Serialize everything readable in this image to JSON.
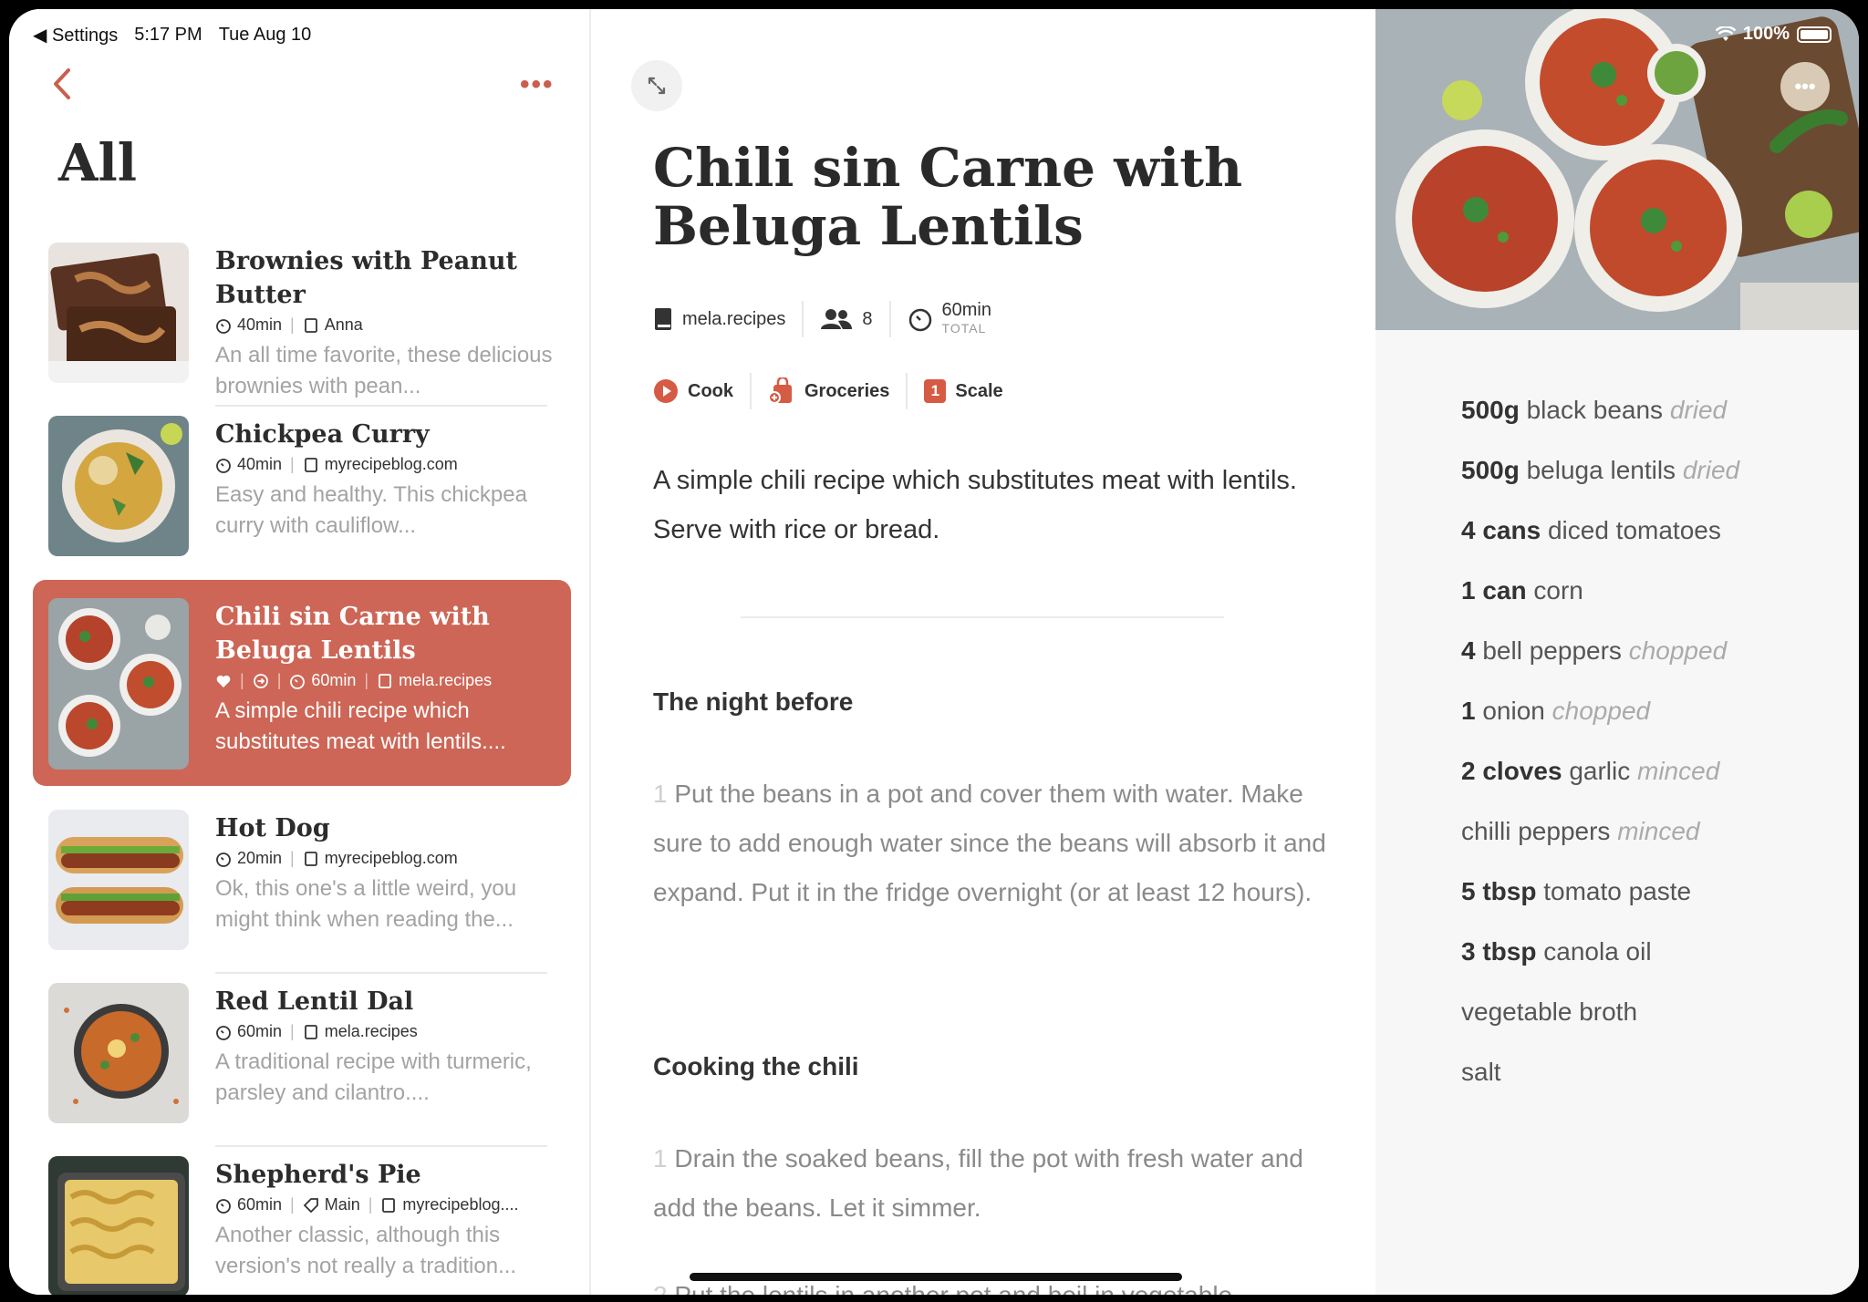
{
  "status_bar": {
    "back_app": "Settings",
    "time": "5:17 PM",
    "date": "Tue Aug 10",
    "battery": "100%"
  },
  "list": {
    "title": "All",
    "recipes": [
      {
        "title": "Brownies with Peanut Butter",
        "time": "40min",
        "source": "Anna",
        "desc": "An all time favorite, these delicious brownies with pean..."
      },
      {
        "title": "Chickpea Curry",
        "time": "40min",
        "source": "myrecipeblog.com",
        "desc": "Easy and healthy. This chickpea curry with cauliflow..."
      },
      {
        "title": "Chili sin Carne with Beluga Lentils",
        "time": "60min",
        "source": "mela.recipes",
        "desc": "A simple chili recipe which substitutes meat with lentils...."
      },
      {
        "title": "Hot Dog",
        "time": "20min",
        "source": "myrecipeblog.com",
        "desc": "Ok, this one's a little weird, you might think when reading the..."
      },
      {
        "title": "Red Lentil Dal",
        "time": "60min",
        "source": "mela.recipes",
        "desc": "A traditional recipe with turmeric, parsley and cilantro...."
      },
      {
        "title": "Shepherd's Pie",
        "time": "60min",
        "category": "Main",
        "source": "myrecipeblog....",
        "desc": "Another classic, although this version's not really a tradition..."
      }
    ]
  },
  "detail": {
    "title": "Chili sin Carne with Beluga Lentils",
    "source": "mela.recipes",
    "servings": "8",
    "total_time": "60min",
    "total_label": "TOTAL",
    "actions": {
      "cook": "Cook",
      "groceries": "Groceries",
      "scale": "Scale",
      "scale_badge": "1"
    },
    "summary": "A simple chili recipe which substitutes meat with lentils. Serve with rice or bread.",
    "sections": [
      {
        "heading": "The night before",
        "step_num": "1",
        "step": "Put the beans in a pot and cover them with water. Make sure to add enough water since the beans will absorb it and expand. Put it in the fridge overnight (or at least 12 hours)."
      },
      {
        "heading": "Cooking the chili",
        "step_num": "1",
        "step": "Drain the soaked beans, fill the pot with fresh water and add the beans. Let it simmer.",
        "step2_num": "2",
        "step2": "Put the lentils in another pot and boil in vegetable"
      }
    ]
  },
  "ingredients": [
    {
      "qty": "500g",
      "name": "black beans",
      "note": "dried"
    },
    {
      "qty": "500g",
      "name": "beluga lentils",
      "note": "dried"
    },
    {
      "qty": "4 cans",
      "name": "diced tomatoes",
      "note": ""
    },
    {
      "qty": "1 can",
      "name": "corn",
      "note": ""
    },
    {
      "qty": "4",
      "name": "bell peppers",
      "note": "chopped"
    },
    {
      "qty": "1",
      "name": "onion",
      "note": "chopped"
    },
    {
      "qty": "2 cloves",
      "name": "garlic",
      "note": "minced"
    },
    {
      "qty": "",
      "name": "chilli peppers",
      "note": "minced"
    },
    {
      "qty": "5 tbsp",
      "name": "tomato paste",
      "note": ""
    },
    {
      "qty": "3 tbsp",
      "name": "canola oil",
      "note": ""
    },
    {
      "qty": "",
      "name": "vegetable broth",
      "note": ""
    },
    {
      "qty": "",
      "name": "salt",
      "note": ""
    }
  ],
  "colors": {
    "accent": "#cd6656",
    "selected_row": "#cd6656"
  }
}
